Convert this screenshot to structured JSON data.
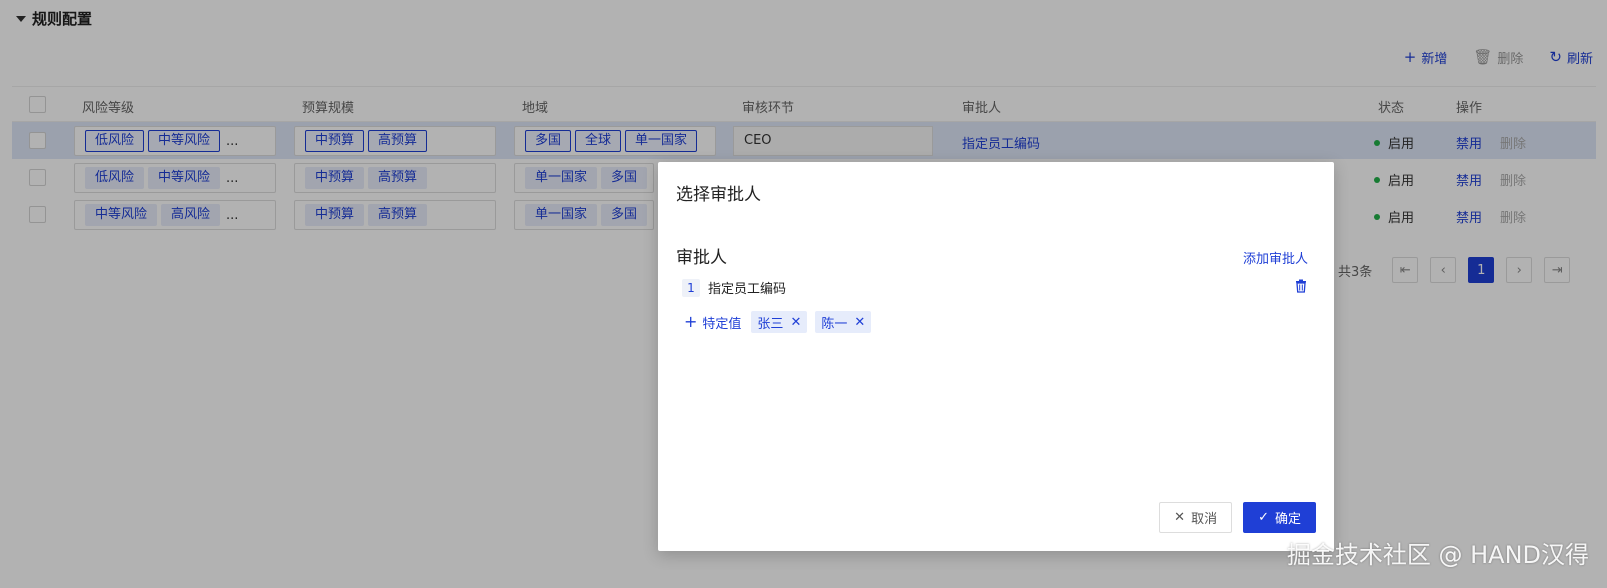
{
  "section": {
    "title": "规则配置"
  },
  "toolbar": {
    "add": "新增",
    "delete": "删除",
    "refresh": "刷新"
  },
  "table": {
    "headers": {
      "risk": "风险等级",
      "budget": "预算规模",
      "region": "地域",
      "review": "审核环节",
      "approver": "审批人",
      "status": "状态",
      "action": "操作"
    },
    "rows": [
      {
        "risk": [
          "低风险",
          "中等风险"
        ],
        "risk_more": "...",
        "budget": [
          "中预算",
          "高预算"
        ],
        "region": [
          "多国",
          "全球",
          "单一国家"
        ],
        "review": "CEO",
        "approver": "指定员工编码",
        "status": "启用",
        "op_disable": "禁用",
        "op_delete": "删除"
      },
      {
        "risk": [
          "低风险",
          "中等风险"
        ],
        "risk_more": "...",
        "budget": [
          "中预算",
          "高预算"
        ],
        "region": [
          "单一国家",
          "多国"
        ],
        "status": "启用",
        "op_disable": "禁用",
        "op_delete": "删除"
      },
      {
        "risk": [
          "中等风险",
          "高风险"
        ],
        "risk_more": "...",
        "budget": [
          "中预算",
          "高预算"
        ],
        "region": [
          "单一国家",
          "多国"
        ],
        "status": "启用",
        "op_disable": "禁用",
        "op_delete": "删除"
      }
    ]
  },
  "pagination": {
    "total": "共3条",
    "current": "1"
  },
  "modal": {
    "title": "选择审批人",
    "section_label": "审批人",
    "add_approver": "添加审批人",
    "approvers": [
      {
        "index": "1",
        "name": "指定员工编码"
      }
    ],
    "add_special": "特定值",
    "chips": [
      "张三",
      "陈一"
    ],
    "cancel": "取消",
    "ok": "确定"
  },
  "watermark": "掘金技术社区 @ HAND汉得",
  "colors": {
    "primary": "#1f3fd6",
    "success": "#22b04a",
    "selected_row": "#dfe7f8"
  }
}
